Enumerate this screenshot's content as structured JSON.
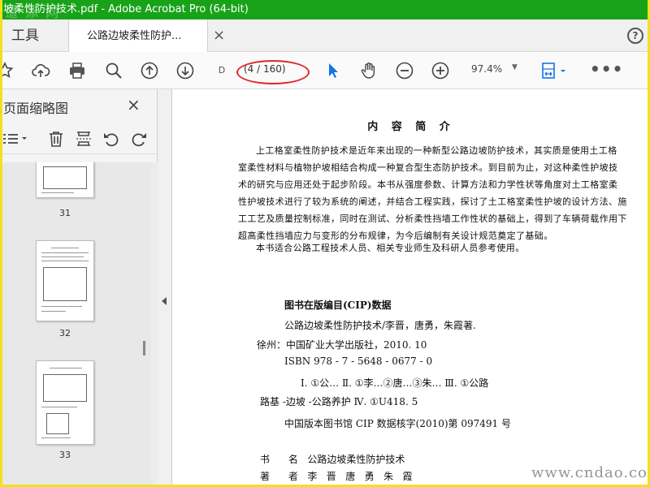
{
  "window": {
    "title": "坡柔性防护技术.pdf - Adobe Acrobat Pro (64-bit)",
    "watermark_top": "道 添 网"
  },
  "tabs": {
    "tools_label": "工具",
    "doc_label": "公路边坡柔性防护...",
    "close_label": "×",
    "help_label": "?"
  },
  "toolbar": {
    "page_input": "D",
    "page_count": "(4 / 160)",
    "zoom": "97.4%",
    "more_label": "•••"
  },
  "sidebar": {
    "title": "页面缩略图",
    "close_label": "×",
    "thumbnails": [
      {
        "label": "31"
      },
      {
        "label": "32"
      },
      {
        "label": "33"
      }
    ]
  },
  "document": {
    "heading": "内 容 简 介",
    "intro_lines": [
      "上工格室柔性防护技术是近年来出现的一种新型公路边坡防护技术，其实质是使用土工格",
      "室柔性材料与植物护坡相结合构成一种复合型生态防护技术。到目前为止，对这种柔性护坡技",
      "术的研究与应用还处于起步阶段。本书从强度参数、计算方法和力学性状等角度对土工格室柔",
      "性护坡技术进行了较为系统的阐述，并结合工程实践，探讨了土工格室柔性护坡的设计方法、施",
      "工工艺及质量控制标准，同时在测试、分析柔性挡墙工作性状的基础上，得到了车辆荷载作用下",
      "超高柔性挡墙应力与变形的分布规律，为今后编制有关设计规范奠定了基础。",
      "本书适合公路工程技术人员、相关专业师生及科研人员参考使用。"
    ],
    "cip_title": "图书在版编目(CIP)数据",
    "cip_lines": [
      "公路边坡柔性防护技术/李晋，唐勇，朱霞著.",
      "徐州：中国矿业大学出版社，2010. 10",
      "ISBN 978 - 7 - 5648 - 0677 - 0",
      "Ⅰ. ①公… Ⅱ. ①李…②唐…③朱… Ⅲ. ①公路",
      "路基 -边坡 -公路养护   Ⅳ. ①U418. 5",
      "中国版本图书馆 CIP 数据核字(2010)第 097491 号"
    ],
    "credit_lines": [
      "书      名   公路边坡柔性防护技术",
      "著      者   李   晋   唐   勇   朱   霞"
    ]
  },
  "watermark_bottom": "www.cndao.com",
  "colors": {
    "titlebar": "#18a218",
    "frame": "#f2e020",
    "annotation": "#e0282c",
    "accent_blue": "#1473e6"
  }
}
